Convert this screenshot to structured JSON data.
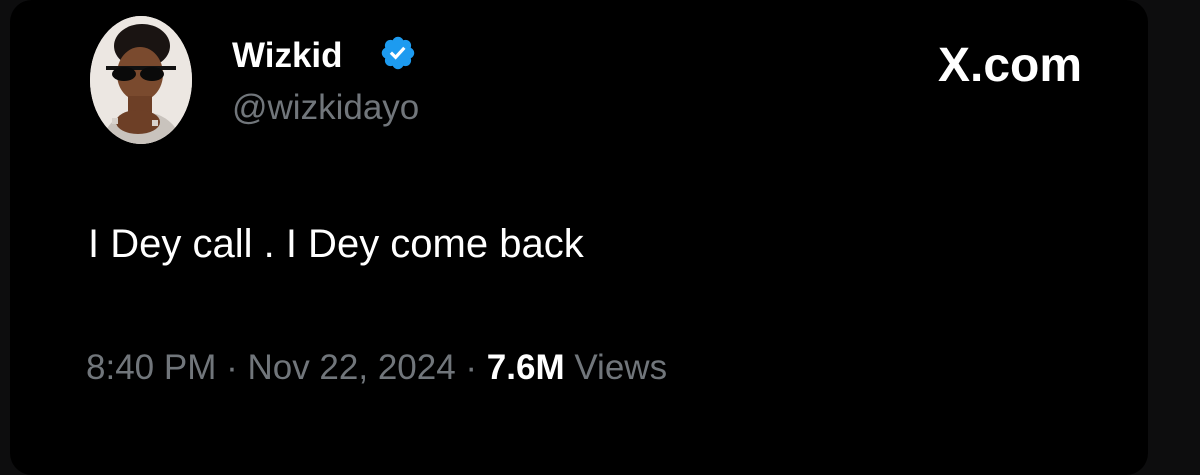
{
  "author": {
    "display_name": "Wizkid",
    "handle": "@wizkidayo",
    "verified_color": "#1d9bf0"
  },
  "brand": "X.com",
  "tweet": {
    "text": "I Dey call . I Dey come back",
    "time": "8:40 PM",
    "separator": " · ",
    "date": "Nov 22, 2024",
    "views_count": "7.6M",
    "views_label": "Views"
  },
  "icons": [
    "avatar",
    "verified-badge-icon"
  ]
}
